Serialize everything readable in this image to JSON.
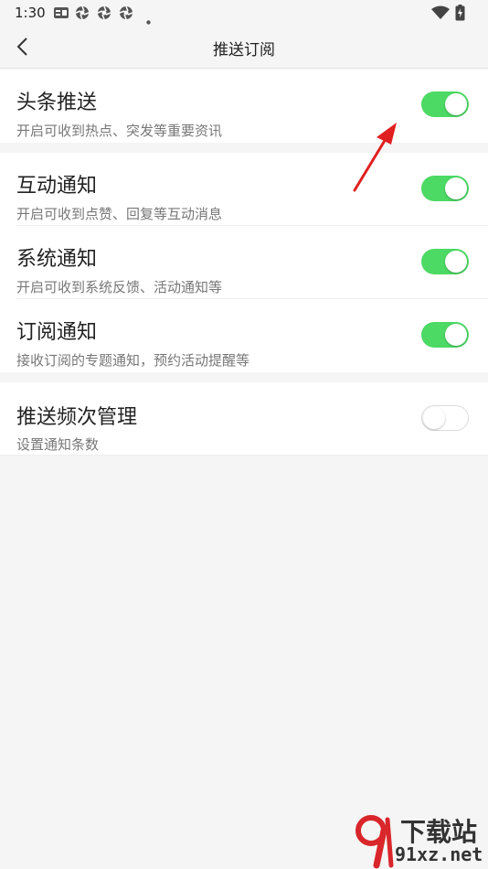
{
  "status_bar": {
    "time": "1:30"
  },
  "header": {
    "title": "推送订阅"
  },
  "settings": [
    {
      "title": "头条推送",
      "subtitle": "开启可收到热点、突发等重要资讯",
      "enabled": true
    },
    {
      "title": "互动通知",
      "subtitle": "开启可收到点赞、回复等互动消息",
      "enabled": true
    },
    {
      "title": "系统通知",
      "subtitle": "开启可收到系统反馈、活动通知等",
      "enabled": true
    },
    {
      "title": "订阅通知",
      "subtitle": "接收订阅的专题通知，预约活动提醒等",
      "enabled": true
    },
    {
      "title": "推送频次管理",
      "subtitle": "设置通知条数",
      "enabled": false
    }
  ],
  "colors": {
    "toggle_on": "#4cd964",
    "annotation_arrow": "#e02020",
    "watermark_red": "#d9262b"
  },
  "watermark": {
    "line1": "下载站",
    "line2": "91xz.net"
  }
}
